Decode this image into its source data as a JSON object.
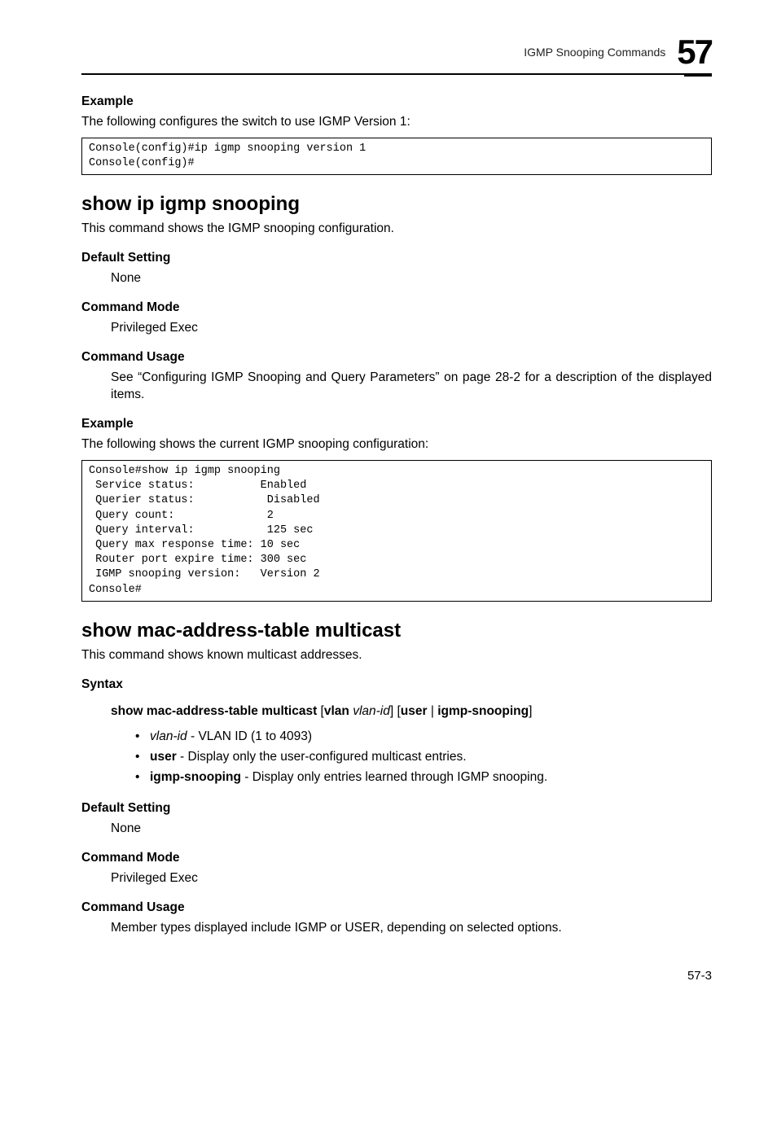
{
  "header": {
    "running": "IGMP Snooping Commands",
    "chapter": "57"
  },
  "s1": {
    "example_h": "Example",
    "example_p": "The following configures the switch to use IGMP Version 1:",
    "code": "Console(config)#ip igmp snooping version 1\nConsole(config)#"
  },
  "s2": {
    "title": "show ip igmp snooping",
    "intro": "This command shows the IGMP snooping configuration.",
    "def_h": "Default Setting",
    "def_v": "None",
    "mode_h": "Command Mode",
    "mode_v": "Privileged Exec",
    "usage_h": "Command Usage",
    "usage_v": "See “Configuring IGMP Snooping and Query Parameters” on page 28-2 for a description of the displayed items.",
    "example_h": "Example",
    "example_p": "The following shows the current IGMP snooping configuration:",
    "code": "Console#show ip igmp snooping\n Service status:          Enabled\n Querier status:           Disabled\n Query count:              2\n Query interval:           125 sec\n Query max response time: 10 sec\n Router port expire time: 300 sec\n IGMP snooping version:   Version 2\nConsole#"
  },
  "s3": {
    "title": "show mac-address-table multicast",
    "intro": "This command shows known multicast addresses.",
    "syntax_h": "Syntax",
    "syntax_bold1": "show mac-address-table multicast",
    "syntax_txt1": " [",
    "syntax_bold2": "vlan",
    "syntax_txt2": " ",
    "syntax_it1": "vlan-id",
    "syntax_txt3": "] [",
    "syntax_bold3": "user",
    "syntax_txt4": " | ",
    "syntax_bold4": "igmp-snooping",
    "syntax_txt5": "]",
    "bul1_it": "vlan-id",
    "bul1_rest": " - VLAN ID (1 to 4093)",
    "bul2_b": "user",
    "bul2_rest": " - Display only the user-configured multicast entries.",
    "bul3_b": "igmp-snooping",
    "bul3_rest": " - Display only entries learned through IGMP snooping.",
    "def_h": "Default Setting",
    "def_v": "None",
    "mode_h": "Command Mode",
    "mode_v": "Privileged Exec",
    "usage_h": "Command Usage",
    "usage_v": "Member types displayed include IGMP or USER, depending on selected options."
  },
  "pagenum": "57-3"
}
